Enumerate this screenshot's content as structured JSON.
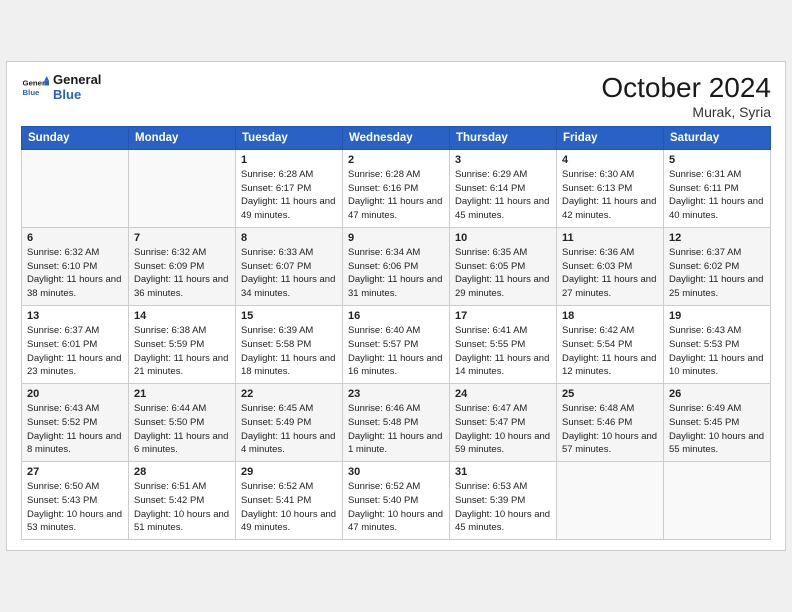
{
  "header": {
    "logo_line1": "General",
    "logo_line2": "Blue",
    "month": "October 2024",
    "location": "Murak, Syria"
  },
  "weekdays": [
    "Sunday",
    "Monday",
    "Tuesday",
    "Wednesday",
    "Thursday",
    "Friday",
    "Saturday"
  ],
  "weeks": [
    [
      null,
      null,
      {
        "day": 1,
        "sunrise": "6:28 AM",
        "sunset": "6:17 PM",
        "daylight": "11 hours and 49 minutes."
      },
      {
        "day": 2,
        "sunrise": "6:28 AM",
        "sunset": "6:16 PM",
        "daylight": "11 hours and 47 minutes."
      },
      {
        "day": 3,
        "sunrise": "6:29 AM",
        "sunset": "6:14 PM",
        "daylight": "11 hours and 45 minutes."
      },
      {
        "day": 4,
        "sunrise": "6:30 AM",
        "sunset": "6:13 PM",
        "daylight": "11 hours and 42 minutes."
      },
      {
        "day": 5,
        "sunrise": "6:31 AM",
        "sunset": "6:11 PM",
        "daylight": "11 hours and 40 minutes."
      }
    ],
    [
      {
        "day": 6,
        "sunrise": "6:32 AM",
        "sunset": "6:10 PM",
        "daylight": "11 hours and 38 minutes."
      },
      {
        "day": 7,
        "sunrise": "6:32 AM",
        "sunset": "6:09 PM",
        "daylight": "11 hours and 36 minutes."
      },
      {
        "day": 8,
        "sunrise": "6:33 AM",
        "sunset": "6:07 PM",
        "daylight": "11 hours and 34 minutes."
      },
      {
        "day": 9,
        "sunrise": "6:34 AM",
        "sunset": "6:06 PM",
        "daylight": "11 hours and 31 minutes."
      },
      {
        "day": 10,
        "sunrise": "6:35 AM",
        "sunset": "6:05 PM",
        "daylight": "11 hours and 29 minutes."
      },
      {
        "day": 11,
        "sunrise": "6:36 AM",
        "sunset": "6:03 PM",
        "daylight": "11 hours and 27 minutes."
      },
      {
        "day": 12,
        "sunrise": "6:37 AM",
        "sunset": "6:02 PM",
        "daylight": "11 hours and 25 minutes."
      }
    ],
    [
      {
        "day": 13,
        "sunrise": "6:37 AM",
        "sunset": "6:01 PM",
        "daylight": "11 hours and 23 minutes."
      },
      {
        "day": 14,
        "sunrise": "6:38 AM",
        "sunset": "5:59 PM",
        "daylight": "11 hours and 21 minutes."
      },
      {
        "day": 15,
        "sunrise": "6:39 AM",
        "sunset": "5:58 PM",
        "daylight": "11 hours and 18 minutes."
      },
      {
        "day": 16,
        "sunrise": "6:40 AM",
        "sunset": "5:57 PM",
        "daylight": "11 hours and 16 minutes."
      },
      {
        "day": 17,
        "sunrise": "6:41 AM",
        "sunset": "5:55 PM",
        "daylight": "11 hours and 14 minutes."
      },
      {
        "day": 18,
        "sunrise": "6:42 AM",
        "sunset": "5:54 PM",
        "daylight": "11 hours and 12 minutes."
      },
      {
        "day": 19,
        "sunrise": "6:43 AM",
        "sunset": "5:53 PM",
        "daylight": "11 hours and 10 minutes."
      }
    ],
    [
      {
        "day": 20,
        "sunrise": "6:43 AM",
        "sunset": "5:52 PM",
        "daylight": "11 hours and 8 minutes."
      },
      {
        "day": 21,
        "sunrise": "6:44 AM",
        "sunset": "5:50 PM",
        "daylight": "11 hours and 6 minutes."
      },
      {
        "day": 22,
        "sunrise": "6:45 AM",
        "sunset": "5:49 PM",
        "daylight": "11 hours and 4 minutes."
      },
      {
        "day": 23,
        "sunrise": "6:46 AM",
        "sunset": "5:48 PM",
        "daylight": "11 hours and 1 minute."
      },
      {
        "day": 24,
        "sunrise": "6:47 AM",
        "sunset": "5:47 PM",
        "daylight": "10 hours and 59 minutes."
      },
      {
        "day": 25,
        "sunrise": "6:48 AM",
        "sunset": "5:46 PM",
        "daylight": "10 hours and 57 minutes."
      },
      {
        "day": 26,
        "sunrise": "6:49 AM",
        "sunset": "5:45 PM",
        "daylight": "10 hours and 55 minutes."
      }
    ],
    [
      {
        "day": 27,
        "sunrise": "6:50 AM",
        "sunset": "5:43 PM",
        "daylight": "10 hours and 53 minutes."
      },
      {
        "day": 28,
        "sunrise": "6:51 AM",
        "sunset": "5:42 PM",
        "daylight": "10 hours and 51 minutes."
      },
      {
        "day": 29,
        "sunrise": "6:52 AM",
        "sunset": "5:41 PM",
        "daylight": "10 hours and 49 minutes."
      },
      {
        "day": 30,
        "sunrise": "6:52 AM",
        "sunset": "5:40 PM",
        "daylight": "10 hours and 47 minutes."
      },
      {
        "day": 31,
        "sunrise": "6:53 AM",
        "sunset": "5:39 PM",
        "daylight": "10 hours and 45 minutes."
      },
      null,
      null
    ]
  ],
  "labels": {
    "sunrise": "Sunrise:",
    "sunset": "Sunset:",
    "daylight": "Daylight:"
  }
}
